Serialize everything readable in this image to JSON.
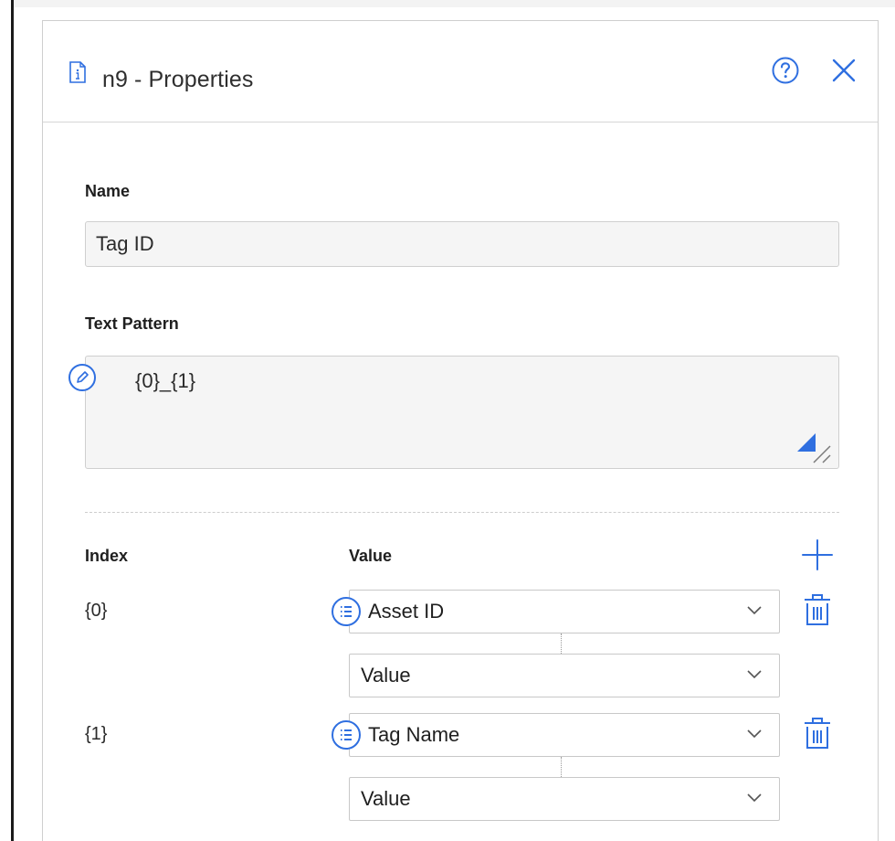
{
  "dialog": {
    "title": "n9 - Properties",
    "help_icon": "help-circle-icon",
    "close_icon": "close-icon",
    "doc_icon": "document-info-icon"
  },
  "name_field": {
    "label": "Name",
    "value": "Tag ID"
  },
  "pattern_field": {
    "label": "Text Pattern",
    "value": "{0}_{1}",
    "edit_icon": "pencil-circle-icon"
  },
  "mapping": {
    "index_header": "Index",
    "value_header": "Value",
    "add_icon": "plus-icon",
    "rows": [
      {
        "index": "{0}",
        "field": "Asset ID",
        "subfield": "Value"
      },
      {
        "index": "{1}",
        "field": "Tag Name",
        "subfield": "Value"
      }
    ]
  },
  "colors": {
    "accent": "#2f6fe0",
    "border": "#cfcfcf",
    "field_bg": "#f5f5f5"
  }
}
